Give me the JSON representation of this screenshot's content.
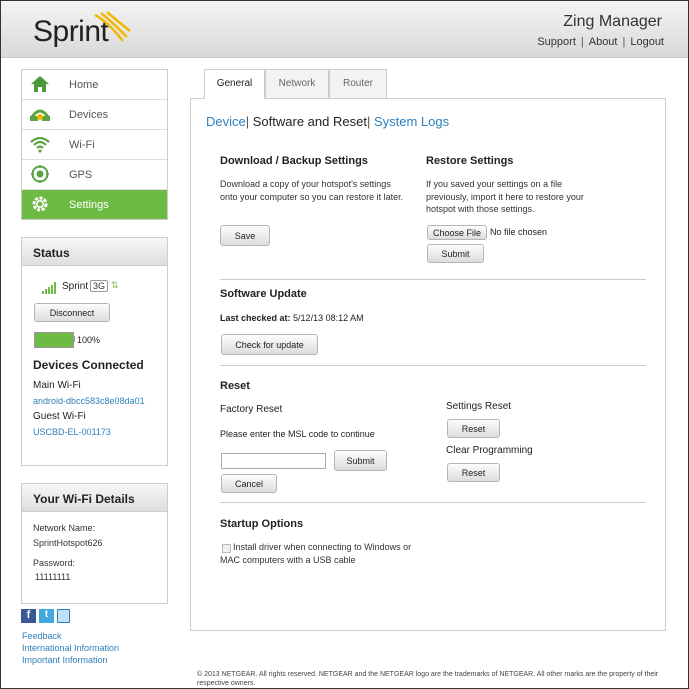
{
  "header": {
    "brand": "Sprint",
    "app_title": "Zing Manager",
    "links": [
      "Support",
      "About",
      "Logout"
    ]
  },
  "nav": {
    "items": [
      {
        "label": "Home",
        "icon": "home-icon"
      },
      {
        "label": "Devices",
        "icon": "devices-icon"
      },
      {
        "label": "Wi-Fi",
        "icon": "wifi-icon"
      },
      {
        "label": "GPS",
        "icon": "gps-icon"
      },
      {
        "label": "Settings",
        "icon": "settings-icon"
      }
    ],
    "active": "Settings"
  },
  "status": {
    "title": "Status",
    "carrier": "Sprint",
    "network": "3G",
    "disconnect_label": "Disconnect",
    "battery": "100%",
    "battery_level": 1.0,
    "devices_connected_title": "Devices Connected",
    "main_wifi_label": "Main Wi-Fi",
    "main_wifi_device": "android-dbcc583c8e08da01",
    "guest_wifi_label": "Guest Wi-Fi",
    "guest_wifi_device": "USCBD-EL-001173"
  },
  "wifi_details": {
    "title": "Your Wi-Fi Details",
    "network_name_label": "Network Name:",
    "network_name": "SprintHotspot626",
    "password_label": "Password:",
    "password": "11111111"
  },
  "social": [
    "facebook-icon",
    "twitter-icon",
    "mobile-icon"
  ],
  "side_links": [
    "Feedback",
    "International Information",
    "Important Information"
  ],
  "tabs": [
    "General",
    "Network",
    "Router"
  ],
  "active_tab": "General",
  "subnav": {
    "device": "Device",
    "software_reset": "Software and Reset",
    "system_logs": "System Logs"
  },
  "download": {
    "title": "Download / Backup Settings",
    "text": "Download a copy of your hotspot's settings onto your computer so you can restore it later.",
    "save_label": "Save"
  },
  "restore": {
    "title": "Restore Settings",
    "text": "If you saved your settings on a file previously, import it here to restore your hotspot with those settings.",
    "choose_label": "Choose File",
    "no_file": "No file chosen",
    "submit_label": "Submit"
  },
  "software_update": {
    "title": "Software Update",
    "last_checked_label": "Last checked at:",
    "last_checked_value": "5/12/13 08:12 AM",
    "check_label": "Check for update"
  },
  "reset": {
    "title": "Reset",
    "factory_title": "Factory Reset",
    "msl_prompt": "Please enter the MSL code to continue",
    "msl_value": "",
    "submit_label": "Submit",
    "cancel_label": "Cancel",
    "settings_reset_title": "Settings Reset",
    "settings_reset_label": "Reset",
    "clear_programming_title": "Clear Programming",
    "clear_programming_label": "Reset"
  },
  "startup": {
    "title": "Startup Options",
    "option_text": "Install driver when connecting to Windows or MAC computers with a USB cable",
    "checked": false
  },
  "footer": "© 2013 NETGEAR. All rights reserved. NETGEAR and the NETGEAR logo are the trademarks of NETGEAR. All other marks are the property of their respective owners.",
  "colors": {
    "accent_green": "#6dbb45",
    "link_blue": "#2f7fbd",
    "brand_yellow": "#f2b705"
  }
}
